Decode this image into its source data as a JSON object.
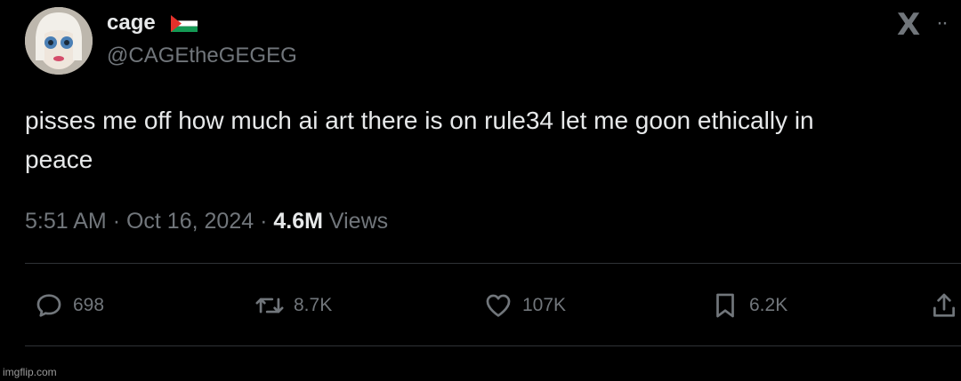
{
  "author": {
    "display_name": "cage",
    "handle": "@CAGEtheGEGEG",
    "flag_icon": "palestine-flag-icon"
  },
  "header": {
    "logo_icon": "x-logo-icon",
    "logo_glyph": "X",
    "more_glyph": "··"
  },
  "tweet": {
    "text": "pisses me off how much ai art there is on rule34 let me goon ethically in\npeace"
  },
  "meta": {
    "time": "5:51 AM",
    "separator": "·",
    "date": "Oct 16, 2024",
    "views_count": "4.6M",
    "views_label": "Views"
  },
  "actions": {
    "reply_count": "698",
    "retweet_count": "8.7K",
    "like_count": "107K",
    "bookmark_count": "6.2K"
  },
  "watermark": "imgflip.com",
  "colors": {
    "background": "#000000",
    "text": "#e7e9ea",
    "secondary": "#71767b",
    "divider": "#2f3336"
  }
}
